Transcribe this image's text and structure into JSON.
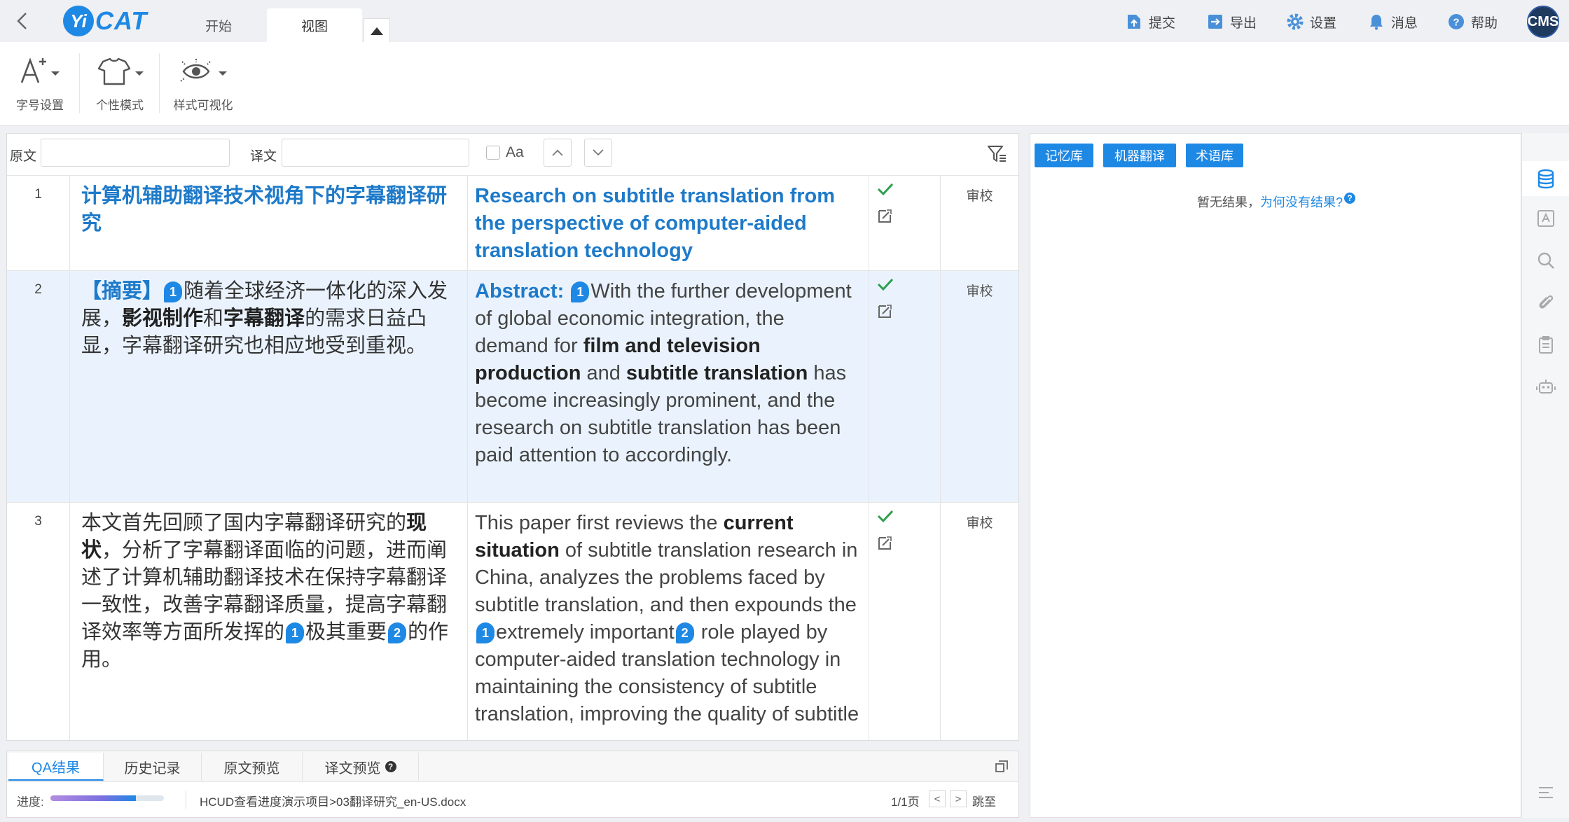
{
  "app": {
    "logo_badge": "Yi",
    "logo_text": "CAT"
  },
  "tabs": [
    {
      "label": "开始"
    },
    {
      "label": "视图"
    }
  ],
  "top_actions": [
    {
      "label": "提交",
      "icon": "submit-icon"
    },
    {
      "label": "导出",
      "icon": "export-icon"
    },
    {
      "label": "设置",
      "icon": "gear-icon"
    },
    {
      "label": "消息",
      "icon": "bell-icon"
    },
    {
      "label": "帮助",
      "icon": "help-icon"
    }
  ],
  "user": {
    "avatar_text": "CMS"
  },
  "ribbon": [
    {
      "label": "字号设置",
      "icon": "font-size-icon"
    },
    {
      "label": "个性模式",
      "icon": "shirt-icon"
    },
    {
      "label": "样式可视化",
      "icon": "eye-icon"
    }
  ],
  "filter": {
    "source_label": "原文",
    "target_label": "译文",
    "source_value": "",
    "target_value": "",
    "case_label": "Aa"
  },
  "segments": [
    {
      "num": "1",
      "review": "审校",
      "source": "计算机辅助翻译技术视角下的字幕翻译研究",
      "target": "Research on subtitle translation from the perspective of computer-aided translation technology"
    },
    {
      "num": "2",
      "review": "审校",
      "source_prefix": "【摘要】",
      "source_tag": "1",
      "source_p1": "随着全球经济一体化的深入发展，",
      "source_b1": "影视制作",
      "source_p2": "和",
      "source_b2": "字幕翻译",
      "source_p3": "的需求日益凸显，字幕翻译研究也相应地受到重视。",
      "target_prefix": "Abstract:",
      "target_tag": "1",
      "target_p1": "With the further development of global economic integration, the demand for ",
      "target_b1": "film and television production",
      "target_p2": " and ",
      "target_b2": "subtitle translation",
      "target_p3": " has become increasingly prominent, and the research on subtitle translation has been paid attention to accordingly."
    },
    {
      "num": "3",
      "review": "审校",
      "source_p1": "本文首先回顾了国内字幕翻译研究的",
      "source_b1": "现状",
      "source_p2": "，分析了字幕翻译面临的问题，进而阐述了计算机辅助翻译技术在保持字幕翻译一致性，改善字幕翻译质量，提高字幕翻译效率等方面所发挥的",
      "source_tag1": "1",
      "source_p3": "极其重要",
      "source_tag2": "2",
      "source_p4": "的作用。",
      "target_p1": "This paper first reviews the ",
      "target_b1": "current situation",
      "target_p2": " of subtitle translation research in China, analyzes the problems faced by subtitle translation, and then expounds the ",
      "target_tag1": "1",
      "target_p3": "extremely important",
      "target_tag2": "2",
      "target_p4": " role played by computer-aided translation technology in maintaining the consistency of subtitle translation, improving the quality of subtitle"
    }
  ],
  "bottom_tabs": [
    {
      "label": "QA结果"
    },
    {
      "label": "历史记录"
    },
    {
      "label": "原文预览"
    },
    {
      "label": "译文预览"
    }
  ],
  "status": {
    "progress_label": "进度:",
    "progress_fraction": 0.75,
    "path": "HCUD查看进度演示项目>03翻译研究_en-US.docx",
    "page": "1/1页",
    "prev": "<",
    "next": ">",
    "jump": "跳至"
  },
  "right_panel": {
    "buttons": [
      {
        "label": "记忆库"
      },
      {
        "label": "机器翻译"
      },
      {
        "label": "术语库"
      }
    ],
    "no_result": "暂无结果，",
    "why_link": "为何没有结果?",
    "why_mark": "?"
  },
  "colors": {
    "accent": "#1e88e5",
    "selected_row": "#eaf3fd",
    "confirmed": "#2e9e4f"
  }
}
